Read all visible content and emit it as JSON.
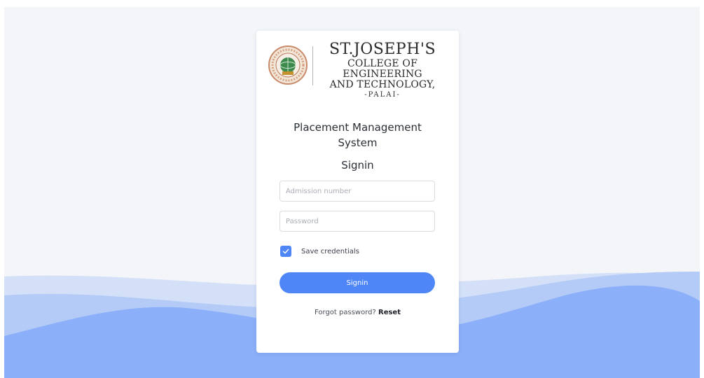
{
  "logo": {
    "line1": "ST.JOSEPH'S",
    "line2": "COLLEGE OF ENGINEERING",
    "line3": "AND TECHNOLOGY,",
    "line4": "-PALAI-"
  },
  "title": {
    "line1": "Placement Management",
    "line2": "System"
  },
  "subtitle": "Signin",
  "form": {
    "username_placeholder": "Admission number",
    "username_value": "",
    "password_placeholder": "Password",
    "password_value": "",
    "remember_label": "Save credentials",
    "remember_checked": true,
    "submit_label": "Signin"
  },
  "footer": {
    "forgot_text": "Forgot password?",
    "reset_label": "Reset"
  },
  "colors": {
    "accent": "#4f86f7",
    "background": "#f3f5f8",
    "wave_light": "#c9d8f7",
    "wave_mid": "#a9c2f6",
    "wave_dark": "#8aaef8"
  }
}
